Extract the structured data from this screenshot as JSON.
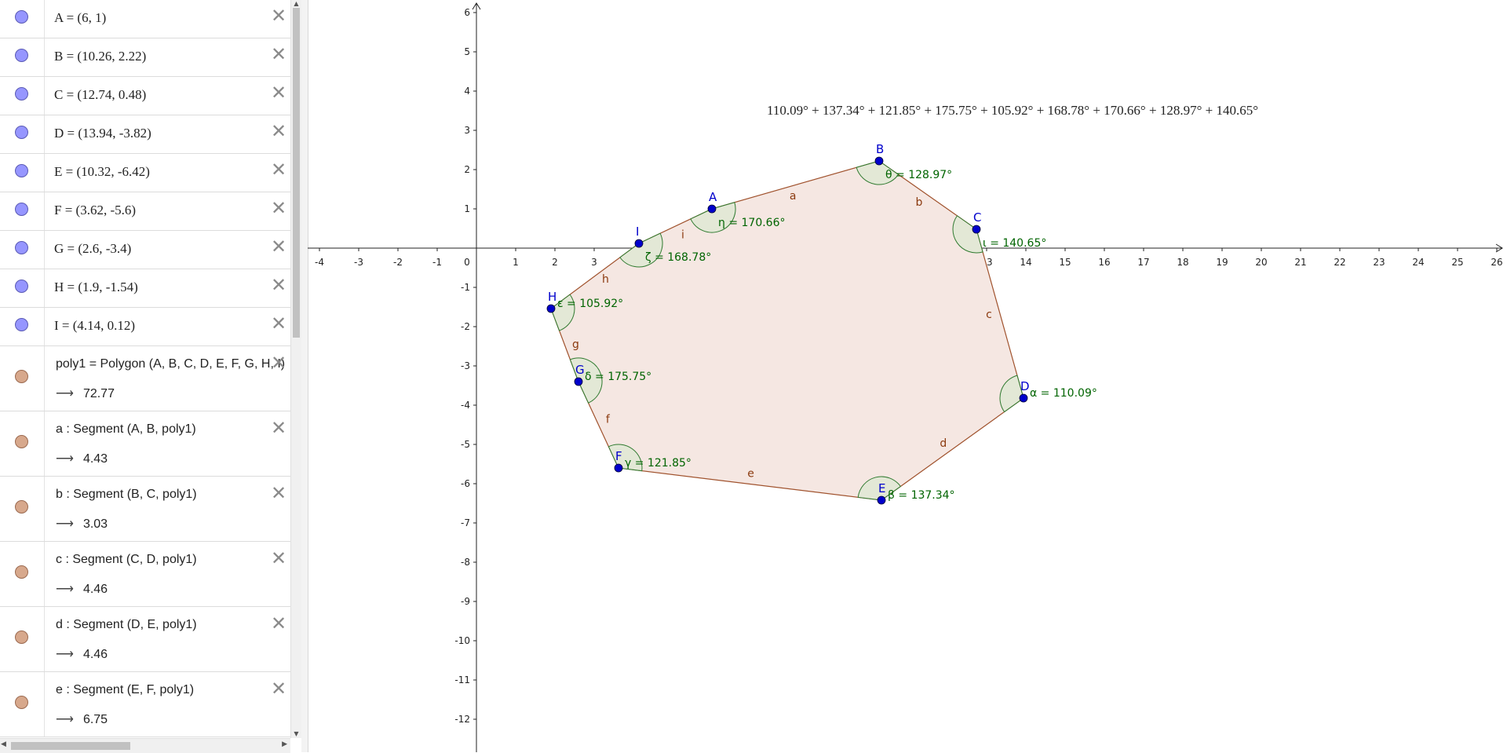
{
  "algebra": {
    "points": [
      {
        "name": "A",
        "def": "A = (6, 1)"
      },
      {
        "name": "B",
        "def": "B = (10.26, 2.22)"
      },
      {
        "name": "C",
        "def": "C = (12.74, 0.48)"
      },
      {
        "name": "D",
        "def": "D = (13.94, -3.82)"
      },
      {
        "name": "E",
        "def": "E = (10.32, -6.42)"
      },
      {
        "name": "F",
        "def": "F = (3.62, -5.6)"
      },
      {
        "name": "G",
        "def": "G = (2.6, -3.4)"
      },
      {
        "name": "H",
        "def": "H = (1.9, -1.54)"
      },
      {
        "name": "I",
        "def": "I = (4.14, 0.12)"
      }
    ],
    "objects": [
      {
        "def": "poly1 = Polygon (A, B, C, D, E, F, G, H, I)",
        "value": "72.77"
      },
      {
        "def": "a : Segment (A, B, poly1)",
        "value": "4.43"
      },
      {
        "def": "b : Segment (B, C, poly1)",
        "value": "3.03"
      },
      {
        "def": "c : Segment (C, D, poly1)",
        "value": "4.46"
      },
      {
        "def": "d : Segment (D, E, poly1)",
        "value": "4.46"
      },
      {
        "def": "e : Segment (E, F, poly1)",
        "value": "6.75"
      }
    ],
    "close_glyph": "✕",
    "result_arrow": "⟶"
  },
  "graphics": {
    "formula": "110.09° + 137.34° + 121.85° + 175.75° + 105.92° + 168.78° + 170.66° + 128.97° + 140.65°",
    "x_ticks": [
      "-4",
      "-3",
      "-2",
      "-1",
      "0",
      "1",
      "2",
      "3",
      "4",
      "5",
      "6",
      "7",
      "8",
      "9",
      "10",
      "11",
      "12",
      "13",
      "14",
      "15",
      "16",
      "17",
      "18",
      "19",
      "20",
      "21",
      "22",
      "23",
      "24",
      "25",
      "26"
    ],
    "y_ticks": [
      "6",
      "5",
      "4",
      "3",
      "2",
      "1",
      "-1",
      "-2",
      "-3",
      "-4",
      "-5",
      "-6",
      "-7",
      "-8",
      "-9",
      "-10",
      "-11",
      "-12"
    ],
    "points": [
      {
        "label": "A",
        "x": 6,
        "y": 1
      },
      {
        "label": "B",
        "x": 10.26,
        "y": 2.22
      },
      {
        "label": "C",
        "x": 12.74,
        "y": 0.48
      },
      {
        "label": "D",
        "x": 13.94,
        "y": -3.82
      },
      {
        "label": "E",
        "x": 10.32,
        "y": -6.42
      },
      {
        "label": "F",
        "x": 3.62,
        "y": -5.6
      },
      {
        "label": "G",
        "x": 2.6,
        "y": -3.4
      },
      {
        "label": "H",
        "x": 1.9,
        "y": -1.54
      },
      {
        "label": "I",
        "x": 4.14,
        "y": 0.12
      }
    ],
    "segment_labels": [
      "a",
      "b",
      "c",
      "d",
      "e",
      "f",
      "g",
      "h",
      "i"
    ],
    "angles": [
      {
        "vertex": "D",
        "label": "α = 110.09°"
      },
      {
        "vertex": "E",
        "label": "β = 137.34°"
      },
      {
        "vertex": "F",
        "label": "γ = 121.85°"
      },
      {
        "vertex": "G",
        "label": "δ = 175.75°"
      },
      {
        "vertex": "H",
        "label": "ε = 105.92°"
      },
      {
        "vertex": "I",
        "label": "ζ = 168.78°"
      },
      {
        "vertex": "A",
        "label": "η = 170.66°"
      },
      {
        "vertex": "B",
        "label": "θ = 128.97°"
      },
      {
        "vertex": "C",
        "label": "ι = 140.65°"
      }
    ],
    "colors": {
      "point": "#0000cc",
      "point_label": "#0000cc",
      "polygon_fill": "#f5e7e2",
      "polygon_stroke": "#a0522d",
      "segment_label": "#8b3a0f",
      "angle_fill": "#dfe8d3",
      "angle_stroke": "#2f7a2f",
      "angle_label": "#006400",
      "axis": "#222222"
    }
  }
}
